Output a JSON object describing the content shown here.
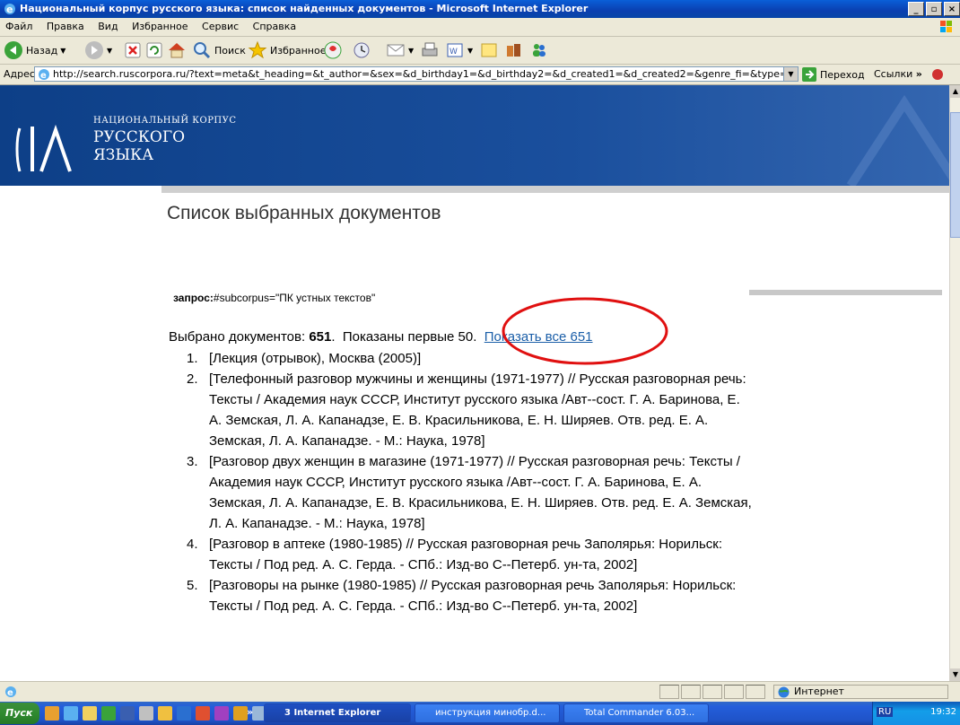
{
  "window": {
    "title": "Национальный корпус русского языка: список найденных документов - Microsoft Internet Explorer",
    "minimize": "_",
    "maximize": "▫",
    "close": "×"
  },
  "menu": [
    "Файл",
    "Правка",
    "Вид",
    "Избранное",
    "Сервис",
    "Справка"
  ],
  "toolbar": {
    "back_label": "Назад",
    "search_label": "Поиск",
    "favorites_label": "Избранное"
  },
  "address": {
    "label": "Адрес:",
    "url": "http://search.ruscorpora.ru/?text=meta&t_heading=&t_author=&sex=&d_birthday1=&d_birthday2=&d_created1=&d_created2=&genre_fi=&type=&chro",
    "go_label": "Переход",
    "links_label": "Ссылки"
  },
  "site": {
    "brand_line1": "НАЦИОНАЛЬНЫЙ КОРПУС",
    "brand_line2": "РУССКОГО",
    "brand_line3": "ЯЗЫКА"
  },
  "page": {
    "title": "Список выбранных документов",
    "query_label": "запрос:",
    "query_value": "#subcorpus=\"ПК устных текстов\"",
    "found_prefix": "Выбрано документов: ",
    "found_count": "651",
    "found_suffix": ".  Показаны первые 50.  ",
    "show_all_link": "Показать все 651"
  },
  "documents": [
    {
      "num": "1.",
      "text": "[Лекция (отрывок), Москва (2005)]"
    },
    {
      "num": "2.",
      "text": "[Телефонный разговор мужчины и женщины (1971-1977) // Русская разговорная речь: Тексты / Академия наук СССР, Институт русского языка /Авт--сост. Г. А. Баринова, Е. А. Земская, Л. А. Капанадзе, Е. В. Красильникова, Е. Н. Ширяев. Отв. ред. Е. А. Земская, Л. А. Капанадзе. - М.: Наука, 1978]"
    },
    {
      "num": "3.",
      "text": "[Разговор двух женщин в магазине (1971-1977) // Русская разговорная речь: Тексты / Академия наук СССР, Институт русского языка /Авт--сост. Г. А. Баринова, Е. А. Земская, Л. А. Капанадзе, Е. В. Красильникова, Е. Н. Ширяев. Отв. ред. Е. А. Земская, Л. А. Капанадзе. - М.: Наука, 1978]"
    },
    {
      "num": "4.",
      "text": "[Разговор в аптеке (1980-1985) // Русская разговорная речь Заполярья: Норильск: Тексты / Под ред. А. С. Герда. - СПб.: Изд-во С--Петерб. ун-та, 2002]"
    },
    {
      "num": "5.",
      "text": "[Разговоры на рынке (1980-1985) // Русская разговорная речь Заполярья: Норильск: Тексты / Под ред. А. С. Герда. - СПб.: Изд-во С--Петерб. ун-та, 2002]"
    }
  ],
  "status": {
    "zone": "Интернет"
  },
  "taskbar": {
    "start_label": "Пуск",
    "chevron": "»",
    "tasks": [
      {
        "label": "3 Internet Explorer"
      },
      {
        "label": "инструкция минобр.d..."
      },
      {
        "label": "Total Commander 6.03..."
      }
    ],
    "lang": "RU",
    "clock": "19:32"
  },
  "colors": {
    "banner": "#0d3f87",
    "link": "#1a5ea8",
    "highlight_oval": "#e01010"
  }
}
